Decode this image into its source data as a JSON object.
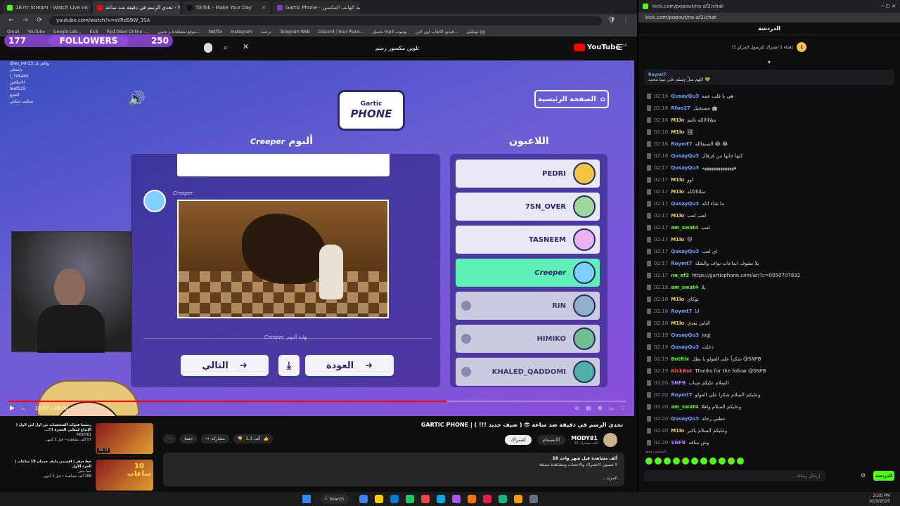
{
  "browser_left": {
    "tabs": [
      {
        "label": "187rr Stream - Watch Live on Kick",
        "color": "#53fc18"
      },
      {
        "label": "تحدي الرسم في دقيقة ضد ساعة - YouTube",
        "color": "#ff0000"
      },
      {
        "label": "TikTok - Make Your Day",
        "color": "#111111"
      },
      {
        "label": "Gartic Phone - لعبة الهاتف المكسور",
        "color": "#7b3fbf"
      }
    ],
    "url": "youtube.com/watch?v=sYRdS9W_3SA",
    "bookmarks": [
      "Gmail",
      "YouTube",
      "Google Lab...",
      "Kick",
      "Red Dead Online -...",
      "موقع مشاهدة و تحمي...",
      "Netflix",
      "Instagram",
      "ترجمة",
      "Telegram Web",
      "Discord | Your Place...",
      "تحميل mp3 يوتيوب",
      "فيديو الالعاب اون لاين...",
      "توبليلي gg"
    ]
  },
  "youtube": {
    "logo": "YouTube",
    "region": "SA",
    "search_value": "تلوين مكسور رسم",
    "title": "تحدي الرسم في دقيقة ضد ساعة 😎 ( ضيف جديد !!! ) | GARTIC PHONE",
    "channel": "MODY81",
    "subscribers": "41 ألف مشترك",
    "join_label": "الانضمام",
    "subscribe_label": "اشتراك",
    "likes": "1.3 ألف",
    "share_label": "مشاركة",
    "save_label": "حفظ",
    "views_line": "18 ألف مشاهدة  قبل شهر واحد",
    "desc_line1": "لا تنسون الاشتراك والاعجاب ومشاهدة ممتعة",
    "more_label": "...المزيد",
    "time": "19:57 / 28:00",
    "progress": 0.71,
    "suggestions": [
      {
        "title": "رسمنا قنوات الشخصيات من أول لين لأول ( الإبداع لمعاني الحجرة !!!...",
        "channel": "MODY81",
        "meta": "57 ألف مشاهدة • قبل 3 أشهر",
        "badge": "44:19"
      },
      {
        "title": "خط سفر | اقسمي دايف حمدان 10 ساعات | الجزء الأول",
        "channel": "خط سفر",
        "meta": "288 ألف مشاهدة • قبل 3 أشهر",
        "thumb_text": "10 ساعات"
      }
    ]
  },
  "overlay": {
    "followers_count": "177",
    "followers_label": "FOLLOWERS",
    "followers_goal": "250",
    "chat_lines": [
      "@su_mn13 ولكم بك",
      "يامنتابر",
      "l_7okami",
      "الاعكاس",
      "leef125",
      "العجع",
      "سكتب سكتي"
    ]
  },
  "game": {
    "home_label": "الصفحة الرئيسية",
    "logo_top": "Gartic",
    "logo_bottom": "PHONE",
    "album_title": "ألبوم",
    "album_owner": "Creeper",
    "players_title": "اللاعبون",
    "drawer_name": "Creeper",
    "end_album": "نهاية ألبوم",
    "back_label": "العودة",
    "next_label": "التالي",
    "players": [
      {
        "name": "PEDRI",
        "state": "active",
        "avatar": "#f4c542"
      },
      {
        "name": "7SN_OVER",
        "state": "active",
        "avatar": "#9fd99a"
      },
      {
        "name": "TASNEEM",
        "state": "active",
        "avatar": "#e8b3f0"
      },
      {
        "name": "Creeper",
        "state": "highlight",
        "avatar": "#7fd0ff"
      },
      {
        "name": "RIN",
        "state": "dim",
        "avatar": "#8fb0c8"
      },
      {
        "name": "HIMIKO",
        "state": "dim",
        "avatar": "#6fc08f"
      },
      {
        "name": "KHALED_QADDOMI",
        "state": "dim",
        "avatar": "#4fb0a8"
      }
    ]
  },
  "browser_right": {
    "url": "kick.com/popout/na-af2/chat",
    "chat_title": "الدردشة",
    "pinned_text": "!إهداء 1 اشتراك للرسول المركز 1",
    "pinned_count": "1",
    "pin_user": "Roymt7",
    "pin_text": "اللهم صلِّ وسلم على نبينا محمد 💚",
    "chat_input_placeholder": "...إرسال رسالة",
    "chat_button": "الدردشة",
    "chat_footer": "المتابعين فقط",
    "messages": [
      {
        "time": "02:16",
        "user": "QusayQu3",
        "color": "#6fa0ff",
        "text": "هي يا قلب عمه"
      },
      {
        "time": "02:16",
        "user": "Rfoo27",
        "color": "#6fa0ff",
        "text": "مستحيل 🤖"
      },
      {
        "time": "02:16",
        "user": "M1lo",
        "color": "#ffd24a",
        "text": "متلااالالله نائيم"
      },
      {
        "time": "02:16",
        "user": "M1lo",
        "color": "#ffd24a",
        "text": "🖼"
      },
      {
        "time": "02:16",
        "user": "Roymt7",
        "color": "#6fa0ff",
        "text": "الصبغالله 😂 😂"
      },
      {
        "time": "02:16",
        "user": "QusayQu3",
        "color": "#6fa0ff",
        "text": "كنها جابها من فرفال"
      },
      {
        "time": "02:17",
        "user": "QusayQu3",
        "color": "#6fa0ff",
        "text": "ههههههههههههههه"
      },
      {
        "time": "02:17",
        "user": "M1lo",
        "color": "#ffd24a",
        "text": "اوو"
      },
      {
        "time": "02:17",
        "user": "M1lo",
        "color": "#ffd24a",
        "text": "متلااالالله"
      },
      {
        "time": "02:17",
        "user": "QusayQu3",
        "color": "#6fa0ff",
        "text": "ما شاء الله"
      },
      {
        "time": "02:17",
        "user": "M1lo",
        "color": "#ffd24a",
        "text": "لعب لعب"
      },
      {
        "time": "02:17",
        "user": "am_swat4",
        "color": "#53fc18",
        "text": "لعب"
      },
      {
        "time": "02:17",
        "user": "M1lo",
        "color": "#ffd24a",
        "text": "🐱"
      },
      {
        "time": "02:17",
        "user": "QusayQu3",
        "color": "#6fa0ff",
        "text": "اي لعب"
      },
      {
        "time": "02:17",
        "user": "Roymt7",
        "color": "#6fa0ff",
        "text": "يلا نشوف ابداعات نواف والشلة"
      },
      {
        "time": "02:17",
        "user": "na_af2",
        "color": "#53fc18",
        "text": "https://garticphone.com/ar/?c=0050707832"
      },
      {
        "time": "02:18",
        "user": "am_swat4",
        "color": "#53fc18",
        "text": "يلا"
      },
      {
        "time": "02:18",
        "user": "M1lo",
        "color": "#ffd24a",
        "text": "توكاي"
      },
      {
        "time": "02:18",
        "user": "Roymt7",
        "color": "#6fa0ff",
        "text": "انا"
      },
      {
        "time": "02:18",
        "user": "M1lo",
        "color": "#ffd24a",
        "text": "الثاني بعدي"
      },
      {
        "time": "02:19",
        "user": "QusayQu3",
        "color": "#6fa0ff",
        "text": "jogj"
      },
      {
        "time": "02:19",
        "user": "QusayQu3",
        "color": "#6fa0ff",
        "text": "دحلت"
      },
      {
        "time": "02:19",
        "user": "BotRix",
        "color": "#53fc18",
        "text": "شكراً على الفولو يا بطل @SNFB"
      },
      {
        "time": "02:19",
        "user": "KickBot",
        "color": "#ff5555",
        "text": "Thanks for the follow @SNFB"
      },
      {
        "time": "02:20",
        "user": "SNFB",
        "color": "#b07cff",
        "text": "السلام عليكم شباب"
      },
      {
        "time": "02:20",
        "user": "Roymt7",
        "color": "#6fa0ff",
        "text": "وعليكم السلام شكرا على الفولو"
      },
      {
        "time": "02:20",
        "user": "am_swat4",
        "color": "#53fc18",
        "text": "وعليكم السلام واهلا"
      },
      {
        "time": "02:20",
        "user": "QusayQu3",
        "color": "#6fa0ff",
        "text": "عطني رجلة"
      },
      {
        "time": "02:20",
        "user": "M1lo",
        "color": "#ffd24a",
        "text": "وعليكم السلام ياكبر"
      },
      {
        "time": "02:20",
        "user": "SNFB",
        "color": "#b07cff",
        "text": "وش ساقه"
      }
    ]
  },
  "taskbar": {
    "search_label": "Search",
    "time": "2:20 PM",
    "date": "10/3/2025",
    "apps": [
      "#3b82f6",
      "#ffcc00",
      "#0078d4",
      "#22c55e",
      "#ef4444",
      "#0ea5e9",
      "#a855f7",
      "#f97316",
      "#e11d48",
      "#10b981",
      "#f59e0b",
      "#64748b"
    ]
  }
}
